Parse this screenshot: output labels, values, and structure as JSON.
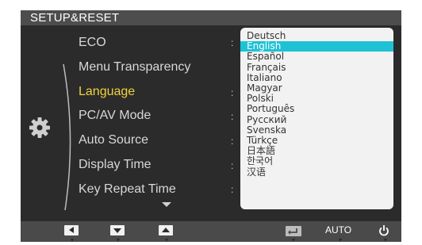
{
  "title": "SETUP&RESET",
  "menu_items": [
    {
      "label": "ECO"
    },
    {
      "label": "Menu Transparency"
    },
    {
      "label": "Language"
    },
    {
      "label": "PC/AV Mode"
    },
    {
      "label": "Auto Source"
    },
    {
      "label": "Display Time"
    },
    {
      "label": "Key Repeat Time"
    }
  ],
  "active_item": "Language",
  "colon": ":",
  "languages": [
    "Deutsch",
    "English",
    "Español",
    "Français",
    "Italiano",
    "Magyar",
    "Polski",
    "Português",
    "Русский",
    "Svenska",
    "Türkçe",
    "日本語",
    "한국어",
    "汉语"
  ],
  "selected_language": "English",
  "bottom_bar": {
    "auto_label": "AUTO"
  },
  "icons": {
    "category": "gear-icon",
    "left": "arrow-left-icon",
    "down": "arrow-down-icon",
    "up": "arrow-up-icon",
    "enter": "enter-icon",
    "power": "power-icon"
  },
  "colors": {
    "panel": "#2b2b2b",
    "titlebar": "#4d4d4d",
    "active_text": "#f0d23c",
    "selection": "#1fc2d4",
    "list_bg": "#f2f2f2"
  }
}
